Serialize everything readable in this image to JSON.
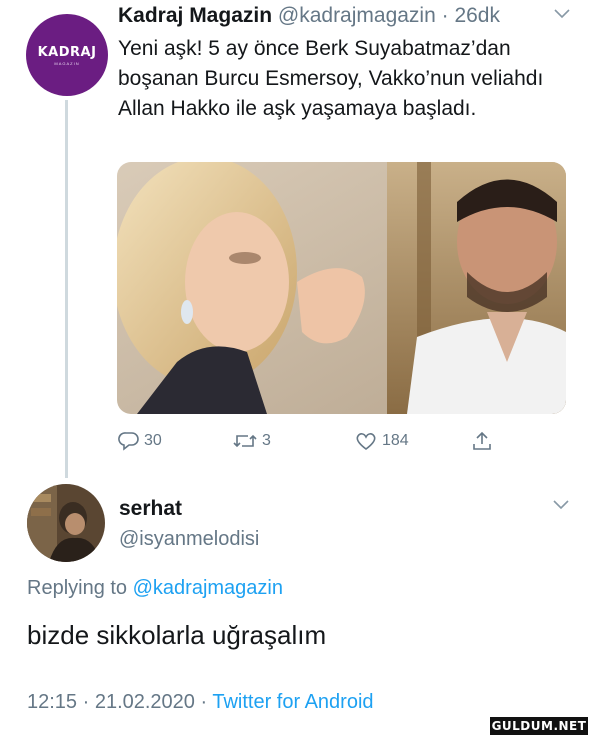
{
  "quoted_tweet": {
    "avatar_logo": "KADRAJ",
    "avatar_logo_sub": "MAGAZIN",
    "name": "Kadraj Magazin",
    "handle": "@kadrajmagazin",
    "separator": " · ",
    "time": "26dk",
    "text": "Yeni aşk! 5 ay önce Berk Suyabatmaz’dan boşanan Burcu Esmersoy, Vakko’nun veliahdı Allan Hakko ile aşk yaşamaya başladı.",
    "reply_count": "30",
    "retweet_count": "3",
    "like_count": "184"
  },
  "reply_tweet": {
    "name": "serhat",
    "handle": "@isyanmelodisi",
    "replying_prefix": "Replying to ",
    "replying_to": "@kadrajmagazin",
    "text": "bizde sikkolarla uğraşalım",
    "timestamp": "12:15 · 21.02.2020 · ",
    "source": "Twitter for Android"
  },
  "watermark": "GULDUM.NET",
  "colors": {
    "accent": "#1da1f2",
    "secondary_text": "#657786",
    "kadraj_purple": "#6b1d82"
  }
}
